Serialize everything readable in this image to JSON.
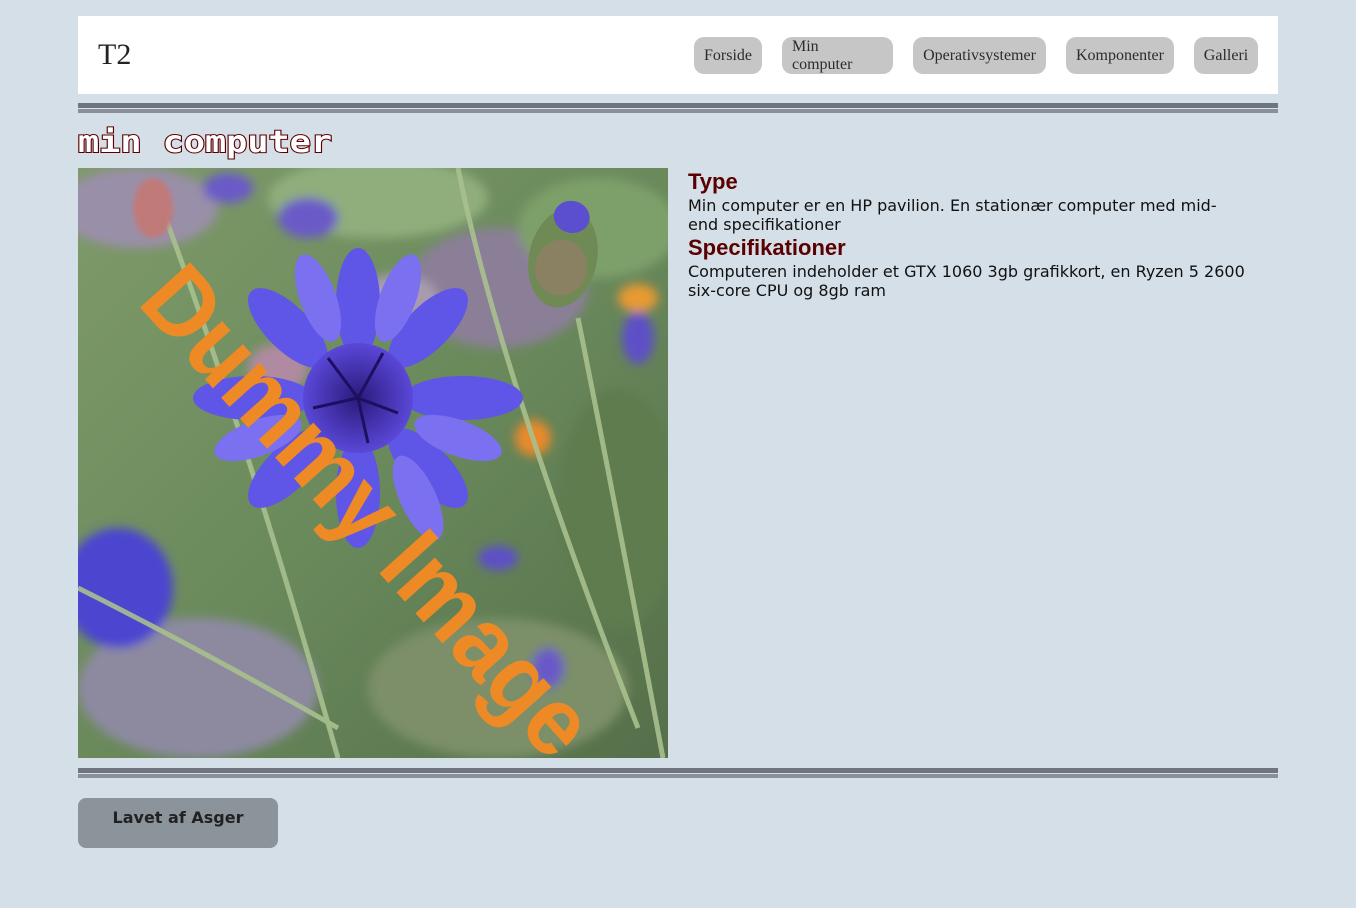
{
  "header": {
    "logo": "T2",
    "nav": [
      "Forside",
      "Min computer",
      "Operativsystemer",
      "Komponenter",
      "Galleri"
    ]
  },
  "page_title": "min computer",
  "image": {
    "watermark": "Dummy Image"
  },
  "sections": [
    {
      "heading": "Type",
      "text": "Min computer er en HP pavilion. En stationær computer med mid-end specifikationer"
    },
    {
      "heading": "Specifikationer",
      "text": "Computeren indeholder et GTX 1060 3gb grafikkort, en Ryzen 5 2600 six-core CPU og 8gb ram"
    }
  ],
  "footer": {
    "credit": "Lavet af Asger"
  },
  "colors": {
    "background": "#d5dfe7",
    "heading": "#5a0000",
    "nav_button": "#c6c6c6",
    "footer_button": "#8b939b",
    "watermark": "#ee8a25"
  }
}
